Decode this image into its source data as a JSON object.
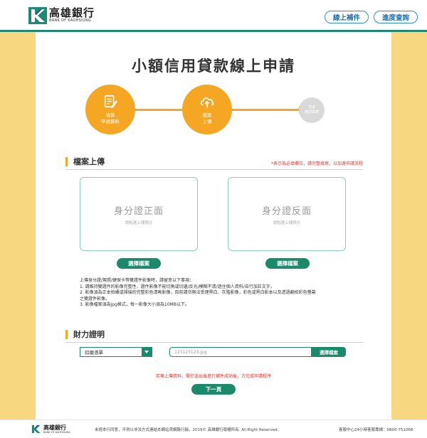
{
  "header": {
    "logo_cn": "高雄銀行",
    "logo_en": "BANK OF KAOHSIUNG",
    "btn_supplement": "線上補件",
    "btn_progress": "進度查詢"
  },
  "page": {
    "title": "小額信用貸款線上申請"
  },
  "steps": [
    {
      "label_line1": "填寫",
      "label_line2": "申請資料",
      "state": "done",
      "icon": "form-edit-icon"
    },
    {
      "label_line1": "檔案",
      "label_line2": "上傳",
      "state": "current",
      "icon": "cloud-upload-icon"
    },
    {
      "label_line1": "完成",
      "label_line2": "確認填寫",
      "state": "pending",
      "icon": ""
    }
  ],
  "upload_section": {
    "title": "檔案上傳",
    "required_note": "*表示為必填欄位，請完整填寫，以加速申請流程",
    "id_front": {
      "title": "身分證正面",
      "hint": "請點選上傳照片",
      "button": "選擇檔案"
    },
    "id_back": {
      "title": "身分證反面",
      "hint": "請點選上傳照片",
      "button": "選擇檔案"
    },
    "notes": [
      "上傳身分證/駕照/健保卡等雙證件影像時，請留意以下事項：",
      "1. 請維持雙證件的影像完整性，證件影像不能切角或切邊/反光/模糊不清/遮住個人資料/自行加註文字。",
      "2. 影像須為正本拍攝或掃描的完整彩色清晰影像，目前請勿無法受理黑白、灰階影像，彩色或黑白影本以及透過翻拍彩色螢幕",
      "之雙證件影像。",
      "3. 影像檔案須為jpg格式，每一影像大小須為10MB以下。"
    ]
  },
  "finance_section": {
    "title": "財力證明",
    "select_value": "扣繳憑單",
    "file_value": "123123123.jpg",
    "file_button": "選擇檔案",
    "warning": "若無上傳資料，需於送出後進行補件成功後，方完成申請程序",
    "next_button": "下一頁"
  },
  "footer": {
    "logo_cn": "高雄銀行",
    "logo_en": "BANK OF KAOHSIUNG",
    "copyright": "未經本行同意，不得以非法方式連結本網站貸網路行銷，2019© 高雄銀行版權所有. All Right Reserved.",
    "service": "客服中心24小時客服專線：0800-751068"
  },
  "colors": {
    "background": "#f7d77f",
    "accent_orange": "#f5a623",
    "brand_green": "#1b8a6b",
    "link_blue": "#2a8fc9",
    "warning_red": "#e0312b"
  }
}
